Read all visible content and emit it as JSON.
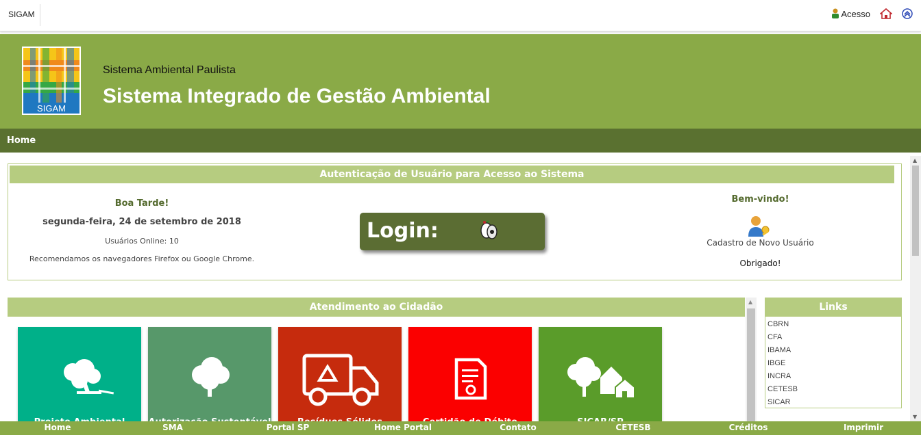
{
  "topbar": {
    "brand": "SIGAM",
    "acesso_label": "Acesso",
    "icons": [
      "user-icon",
      "home-icon",
      "scroll-top-icon"
    ]
  },
  "header": {
    "logo_text": "SIGAM",
    "subtitle": "Sistema Ambiental Paulista",
    "title": "Sistema Integrado de Gestão Ambiental"
  },
  "nav": {
    "home": "Home"
  },
  "auth": {
    "header": "Autenticação de Usuário para Acesso ao Sistema",
    "greeting": "Boa Tarde!",
    "date": "segunda-feira, 24 de setembro de 2018",
    "online": "Usuários Online: 10",
    "recommend": "Recomendamos os navegadores Firefox ou Google Chrome.",
    "login_label": "Login:",
    "welcome": "Bem-vindo!",
    "signup": "Cadastro de Novo Usuário",
    "thanks": "Obrigado!"
  },
  "atendimento": {
    "header": "Atendimento ao Cidadão",
    "tiles": [
      {
        "label": "Projeto Ambiental",
        "color": "#00b089",
        "icon": "tree-cut-icon"
      },
      {
        "label": "Autorização Sustentável",
        "color": "#57986a",
        "icon": "tree-icon"
      },
      {
        "label": "Resíduos Sólidos",
        "color": "#c62b0d",
        "icon": "recycle-truck-icon"
      },
      {
        "label": "Certidão de Débito",
        "color": "#fb0000",
        "icon": "certificate-icon"
      },
      {
        "label": "SICAR/SP",
        "color": "#5a9c2a",
        "icon": "tree-house-icon"
      }
    ]
  },
  "links": {
    "header": "Links",
    "items": [
      "CBRN",
      "CFA",
      "IBAMA",
      "IBGE",
      "INCRA",
      "CETESB",
      "SICAR"
    ]
  },
  "footer": {
    "items": [
      "Home",
      "SMA",
      "Portal SP",
      "Home Portal",
      "Contato",
      "CETESB",
      "Créditos",
      "Imprimir"
    ]
  },
  "colors": {
    "header_green": "#8aaa47",
    "nav_dark_green": "#5a7130",
    "section_header_green": "#b6cc80",
    "login_button": "#5b6d33"
  }
}
